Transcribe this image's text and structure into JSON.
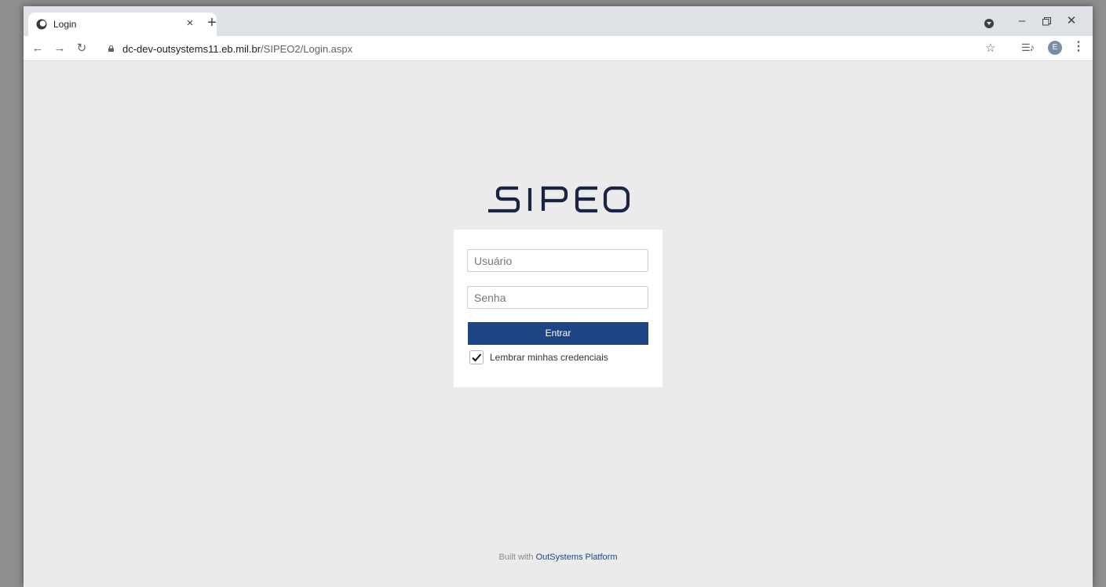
{
  "browser": {
    "tab_title": "Login",
    "tab_close": "×",
    "new_tab": "+",
    "url_host": "dc-dev-outsystems11.eb.mil.br",
    "url_path": "/SIPEO2/Login.aspx",
    "avatar_letter": "E",
    "icons": [
      "back-icon",
      "forward-icon",
      "reload-icon",
      "lock-icon",
      "star-icon",
      "media-icon",
      "menu-icon"
    ]
  },
  "logo": {
    "text": "SIPEO",
    "color": "#1a2444"
  },
  "login": {
    "username_placeholder": "Usuário",
    "password_placeholder": "Senha",
    "submit_label": "Entrar",
    "remember_label": "Lembrar minhas credenciais",
    "remember_checked": true
  },
  "footer": {
    "prefix": "Built with",
    "link": "OutSystems Platform"
  },
  "colors": {
    "button": "#1d4585",
    "page_background": "#ebebeb"
  }
}
